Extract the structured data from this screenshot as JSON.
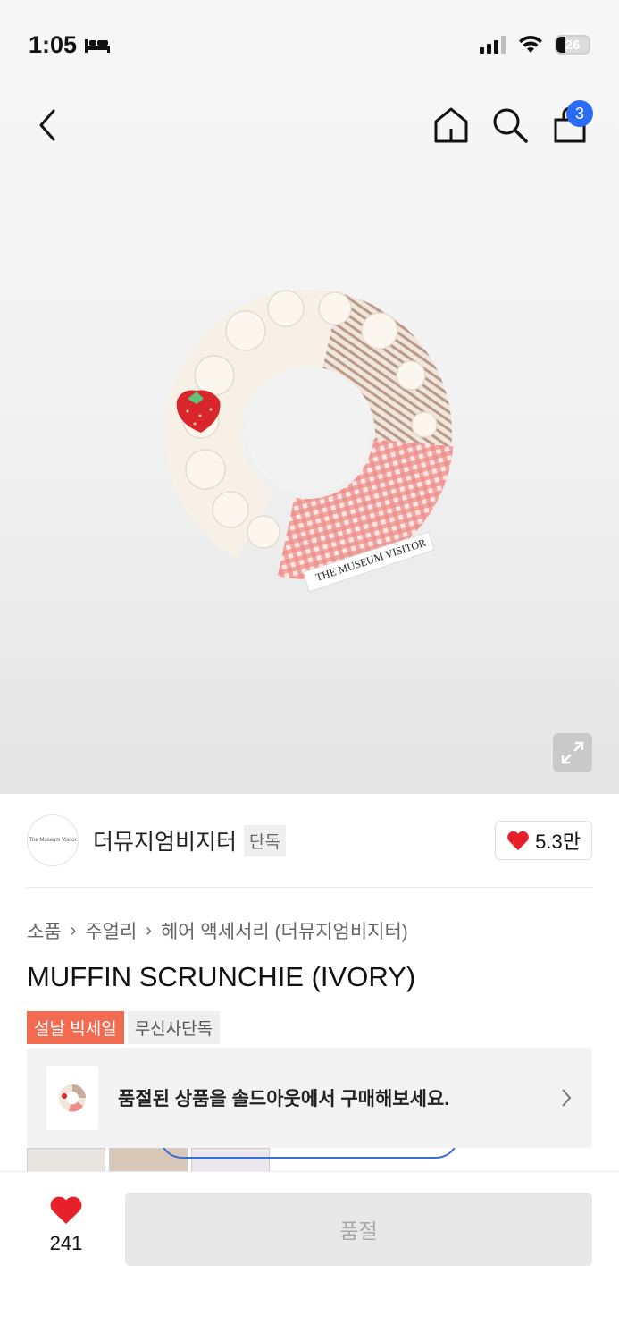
{
  "status_bar": {
    "time": "1:05",
    "battery": "26"
  },
  "nav": {
    "cart_count": "3"
  },
  "product_image": {
    "label_text": "THE MUSEUM VISITOR"
  },
  "brand": {
    "logo_text": "The Museum Visitor",
    "name": "더뮤지엄비지터",
    "tag": "단독",
    "likes": "5.3만"
  },
  "breadcrumb": [
    "소품",
    "주얼리",
    "헤어 액세서리 (더뮤지엄비지터)"
  ],
  "product": {
    "title": "MUFFIN SCRUNCHIE (IVORY)",
    "badges": {
      "sale": "설날 빅세일",
      "exclusive": "무신사단독"
    }
  },
  "soldout_banner": {
    "text": "품절된 상품을 솔드아웃에서 구매해보세요."
  },
  "bottom_bar": {
    "wish_count": "241",
    "buy_label": "품절"
  },
  "colors": {
    "accent_blue": "#2b6cf6",
    "heart_red": "#e8202a",
    "sale_red": "#f16b51"
  }
}
